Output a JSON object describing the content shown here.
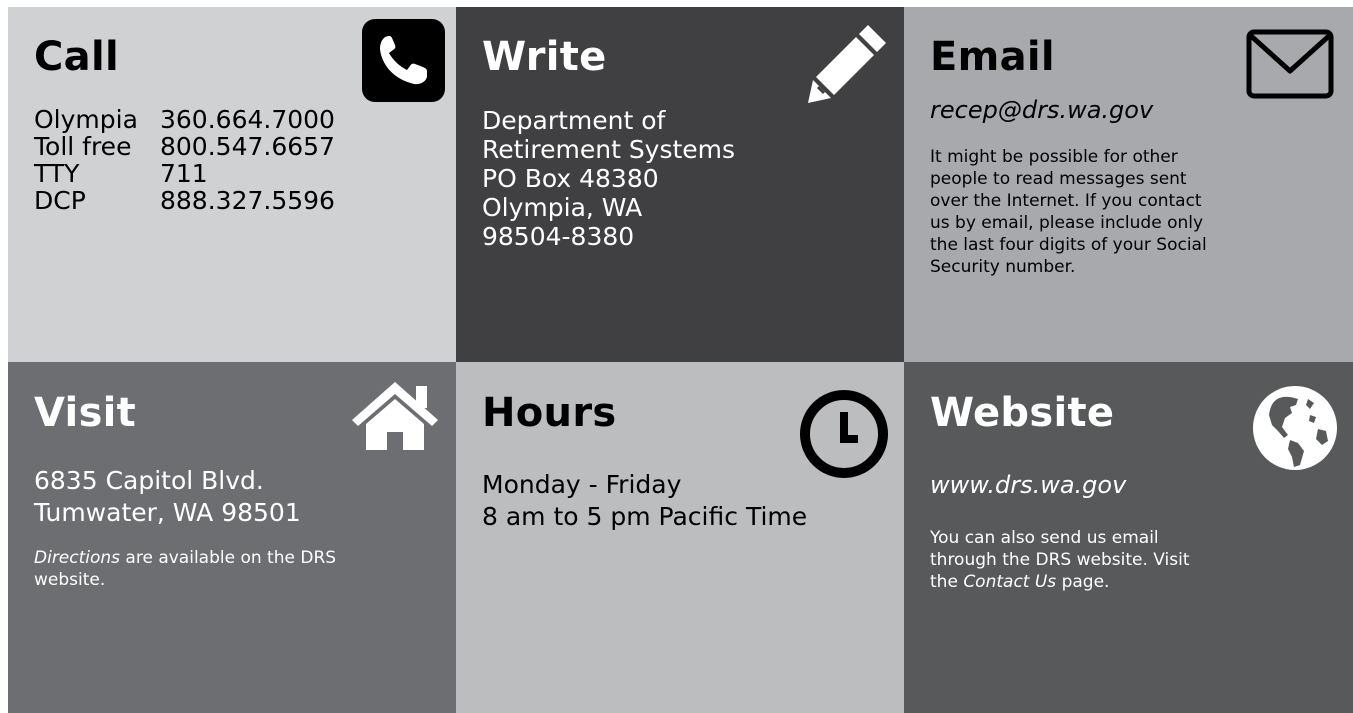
{
  "call": {
    "title": "Call",
    "rows": [
      {
        "label": "Olympia",
        "number": "360.664.7000"
      },
      {
        "label": "Toll free",
        "number": "800.547.6657"
      },
      {
        "label": "TTY",
        "number": "711"
      },
      {
        "label": "DCP",
        "number": "888.327.5596"
      }
    ],
    "icon": "phone-icon"
  },
  "write": {
    "title": "Write",
    "lines": [
      "Department of",
      "Retirement Systems",
      "PO Box 48380",
      "Olympia, WA",
      "98504-8380"
    ],
    "icon": "pencil-icon"
  },
  "email": {
    "title": "Email",
    "address": "recep@drs.wa.gov",
    "note": "It might be possible for other people to read messages sent over the Internet. If you contact us by email, please include only the last four digits of your Social Security number.",
    "icon": "envelope-icon"
  },
  "visit": {
    "title": "Visit",
    "lines": [
      "6835 Capitol Blvd.",
      "Tumwater, WA 98501"
    ],
    "note_link": "Directions",
    "note_rest": " are available on the DRS website.",
    "icon": "house-icon"
  },
  "hours": {
    "title": "Hours",
    "lines": [
      "Monday - Friday",
      "8 am to 5 pm Pacific Time"
    ],
    "icon": "clock-icon"
  },
  "website": {
    "title": "Website",
    "url": "www.drs.wa.gov",
    "note_pre": "You can also send us email through the DRS website. Visit the ",
    "note_link": "Contact Us",
    "note_post": " page.",
    "icon": "globe-icon"
  },
  "colors": {
    "call": "#d0d1d3",
    "write": "#404042",
    "email": "#a7a9ac",
    "visit": "#6d6e71",
    "hours": "#bbbdbf",
    "website": "#58595b"
  }
}
